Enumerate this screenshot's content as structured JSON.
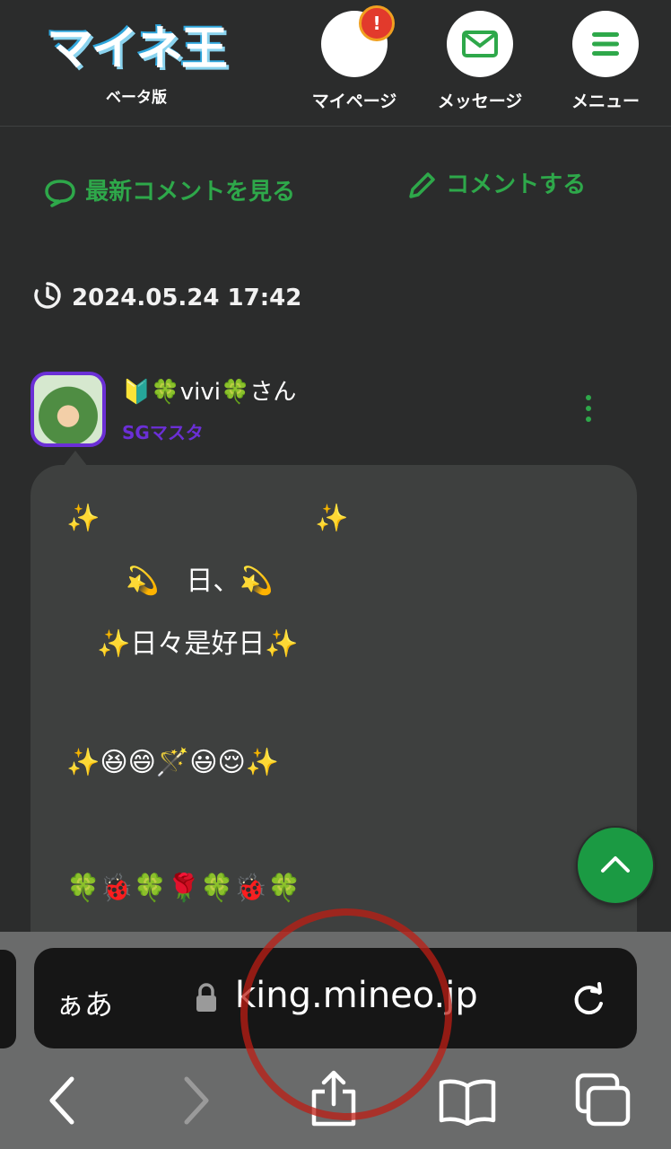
{
  "header": {
    "logo_text": "マイネ王",
    "logo_sub": "ベータ版",
    "mypage_label": "マイページ",
    "mypage_badge": "!",
    "message_label": "メッセージ",
    "menu_label": "メニュー"
  },
  "actions": {
    "latest_comments": "最新コメントを見る",
    "post_comment": "コメントする"
  },
  "post": {
    "timestamp": "2024.05.24 17:42",
    "username": "🔰🍀vivi🍀さん",
    "role": "SGマスタ",
    "lines": [
      "✨　　　　　　　　✨",
      "💫　日、💫",
      "✨日々是好日✨",
      "✨😆😄🪄😃😌✨",
      "🍀🐞🍀🌹🍀🐞🍀"
    ]
  },
  "browser": {
    "text_size": "ぁあ",
    "url": "king.mineo.jp"
  },
  "colors": {
    "accent_green": "#2ea84a",
    "role_purple": "#6b2fd6",
    "background": "#2b2c2c",
    "bubble": "#3e403f"
  }
}
